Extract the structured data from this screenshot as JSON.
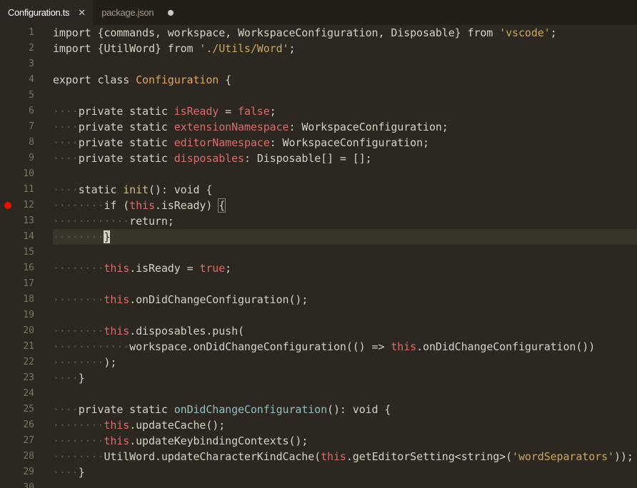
{
  "tabs": [
    {
      "label": "Configuration.ts",
      "active": true,
      "close_glyph": "✕"
    },
    {
      "label": "package.json",
      "active": false,
      "dirty": true
    }
  ],
  "lines": [
    {
      "n": "1",
      "tokens": [
        [
          "kw",
          "import "
        ],
        [
          "pl",
          "{commands, workspace, WorkspaceConfiguration, Disposable} "
        ],
        [
          "kw",
          "from "
        ],
        [
          "str",
          "'vscode'"
        ],
        [
          "pl",
          ";"
        ]
      ]
    },
    {
      "n": "2",
      "tokens": [
        [
          "kw",
          "import "
        ],
        [
          "pl",
          "{UtilWord} "
        ],
        [
          "kw",
          "from "
        ],
        [
          "str",
          "'./Utils/Word'"
        ],
        [
          "pl",
          ";"
        ]
      ]
    },
    {
      "n": "3",
      "tokens": []
    },
    {
      "n": "4",
      "tokens": [
        [
          "kw",
          "export class "
        ],
        [
          "cls",
          "Configuration"
        ],
        [
          "pl",
          " {"
        ]
      ]
    },
    {
      "n": "5",
      "tokens": []
    },
    {
      "n": "6",
      "tokens": [
        [
          "ws",
          "····"
        ],
        [
          "kw",
          "private static "
        ],
        [
          "prop",
          "isReady"
        ],
        [
          "pl",
          " = "
        ],
        [
          "bool",
          "false"
        ],
        [
          "pl",
          ";"
        ]
      ]
    },
    {
      "n": "7",
      "tokens": [
        [
          "ws",
          "····"
        ],
        [
          "kw",
          "private static "
        ],
        [
          "prop",
          "extensionNamespace"
        ],
        [
          "pl",
          ": WorkspaceConfiguration;"
        ]
      ]
    },
    {
      "n": "8",
      "tokens": [
        [
          "ws",
          "····"
        ],
        [
          "kw",
          "private static "
        ],
        [
          "prop",
          "editorNamespace"
        ],
        [
          "pl",
          ": WorkspaceConfiguration;"
        ]
      ]
    },
    {
      "n": "9",
      "tokens": [
        [
          "ws",
          "····"
        ],
        [
          "kw",
          "private static "
        ],
        [
          "prop",
          "disposables"
        ],
        [
          "pl",
          ": Disposable[] = [];"
        ]
      ]
    },
    {
      "n": "10",
      "tokens": []
    },
    {
      "n": "11",
      "tokens": [
        [
          "ws",
          "····"
        ],
        [
          "kw",
          "static "
        ],
        [
          "fn",
          "init"
        ],
        [
          "pl",
          "(): void {"
        ]
      ]
    },
    {
      "n": "12",
      "tokens": [
        [
          "ws",
          "········"
        ],
        [
          "kw",
          "if "
        ],
        [
          "pl",
          "("
        ],
        [
          "this",
          "this"
        ],
        [
          "pl",
          ".isReady) "
        ],
        [
          "bhl",
          "{"
        ]
      ],
      "breakpoint": true
    },
    {
      "n": "13",
      "tokens": [
        [
          "ws",
          "············"
        ],
        [
          "kw",
          "return"
        ],
        [
          "pl",
          ";"
        ]
      ]
    },
    {
      "n": "14",
      "tokens": [
        [
          "ws",
          "········"
        ],
        [
          "cur",
          "}"
        ]
      ],
      "current": true
    },
    {
      "n": "15",
      "tokens": []
    },
    {
      "n": "16",
      "tokens": [
        [
          "ws",
          "········"
        ],
        [
          "this",
          "this"
        ],
        [
          "pl",
          ".isReady = "
        ],
        [
          "bool",
          "true"
        ],
        [
          "pl",
          ";"
        ]
      ]
    },
    {
      "n": "17",
      "tokens": []
    },
    {
      "n": "18",
      "tokens": [
        [
          "ws",
          "········"
        ],
        [
          "this",
          "this"
        ],
        [
          "pl",
          ".onDidChangeConfiguration();"
        ]
      ]
    },
    {
      "n": "19",
      "tokens": []
    },
    {
      "n": "20",
      "tokens": [
        [
          "ws",
          "········"
        ],
        [
          "this",
          "this"
        ],
        [
          "pl",
          ".disposables.push("
        ]
      ]
    },
    {
      "n": "21",
      "tokens": [
        [
          "ws",
          "············"
        ],
        [
          "pl",
          "workspace.onDidChangeConfiguration(() => "
        ],
        [
          "this",
          "this"
        ],
        [
          "pl",
          ".onDidChangeConfiguration())"
        ]
      ]
    },
    {
      "n": "22",
      "tokens": [
        [
          "ws",
          "········"
        ],
        [
          "pl",
          ");"
        ]
      ]
    },
    {
      "n": "23",
      "tokens": [
        [
          "ws",
          "····"
        ],
        [
          "pl",
          "}"
        ]
      ]
    },
    {
      "n": "24",
      "tokens": []
    },
    {
      "n": "25",
      "tokens": [
        [
          "ws",
          "····"
        ],
        [
          "kw",
          "private static "
        ],
        [
          "mth",
          "onDidChangeConfiguration"
        ],
        [
          "pl",
          "(): void {"
        ]
      ]
    },
    {
      "n": "26",
      "tokens": [
        [
          "ws",
          "········"
        ],
        [
          "this",
          "this"
        ],
        [
          "pl",
          ".updateCache();"
        ]
      ]
    },
    {
      "n": "27",
      "tokens": [
        [
          "ws",
          "········"
        ],
        [
          "this",
          "this"
        ],
        [
          "pl",
          ".updateKeybindingContexts();"
        ]
      ]
    },
    {
      "n": "28",
      "tokens": [
        [
          "ws",
          "········"
        ],
        [
          "pl",
          "UtilWord.updateCharacterKindCache("
        ],
        [
          "this",
          "this"
        ],
        [
          "pl",
          ".getEditorSetting<string>("
        ],
        [
          "str",
          "'wordSeparators'"
        ],
        [
          "pl",
          "));"
        ]
      ]
    },
    {
      "n": "29",
      "tokens": [
        [
          "ws",
          "····"
        ],
        [
          "pl",
          "}"
        ]
      ]
    },
    {
      "n": "30",
      "tokens": []
    }
  ],
  "colors": {
    "background": "#2c2720",
    "tabbar": "#221e18",
    "breakpoint": "#e51400",
    "string": "#c9a85c",
    "class_name": "#e1a360",
    "property": "#d96c6a"
  }
}
